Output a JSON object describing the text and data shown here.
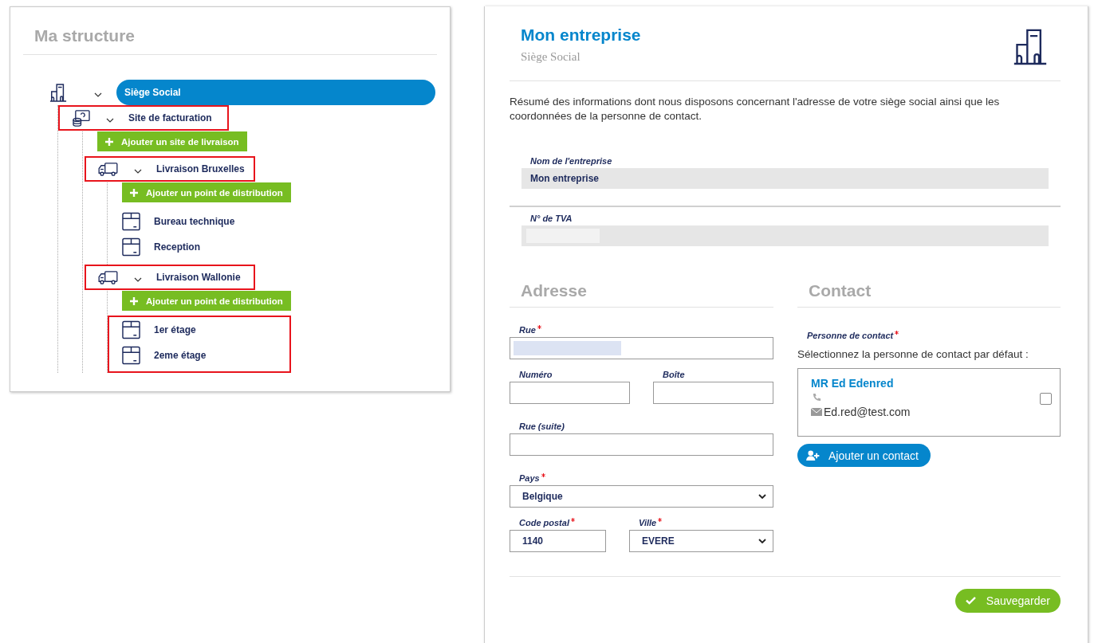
{
  "structure": {
    "title": "Ma structure",
    "root": {
      "label": "Siège Social",
      "selected": true,
      "expanded": true,
      "children": [
        {
          "kind": "billing",
          "label": "Site de facturation",
          "expanded": true,
          "highlighted": true,
          "add_label": "Ajouter un site de livraison",
          "children": [
            {
              "kind": "delivery",
              "label": "Livraison Bruxelles",
              "expanded": true,
              "highlighted": true,
              "add_label": "Ajouter un point de distribution",
              "children_highlighted": false,
              "children": [
                {
                  "kind": "point",
                  "label": "Bureau technique"
                },
                {
                  "kind": "point",
                  "label": "Reception"
                }
              ]
            },
            {
              "kind": "delivery",
              "label": "Livraison Wallonie",
              "expanded": true,
              "highlighted": true,
              "add_label": "Ajouter un point de distribution",
              "children_highlighted": true,
              "children": [
                {
                  "kind": "point",
                  "label": "1er étage"
                },
                {
                  "kind": "point",
                  "label": "2eme étage"
                }
              ]
            }
          ]
        }
      ]
    }
  },
  "company": {
    "title": "Mon entreprise",
    "subtitle": "Siège Social",
    "intro": "Résumé des informations dont nous disposons concernant l'adresse de votre siège social ainsi que les coordonnées de la personne de contact.",
    "info_fields": [
      {
        "label": "Nom de l'entreprise",
        "value": "Mon entreprise",
        "redacted": false
      },
      {
        "label": "N° de TVA",
        "redacted": true
      }
    ]
  },
  "address": {
    "title": "Adresse",
    "street": {
      "label": "Rue",
      "required": true,
      "redacted": true
    },
    "number": {
      "label": "Numéro",
      "required": false
    },
    "box": {
      "label": "Boîte",
      "required": false
    },
    "street2": {
      "label": "Rue (suite)",
      "required": false
    },
    "country": {
      "label": "Pays",
      "required": true,
      "value": "Belgique"
    },
    "postal_code": {
      "label": "Code postal",
      "required": true,
      "value": "1140"
    },
    "city": {
      "label": "Ville",
      "required": true,
      "value": "EVERE"
    }
  },
  "contact": {
    "title": "Contact",
    "label": "Personne de contact",
    "required": true,
    "hint": "Sélectionnez la personne de contact par défaut :",
    "contacts": [
      {
        "name": "MR Ed Edenred",
        "email": "Ed.red@test.com",
        "checked": false
      }
    ],
    "add_button": "Ajouter un contact"
  },
  "save_button": "Sauvegarder"
}
